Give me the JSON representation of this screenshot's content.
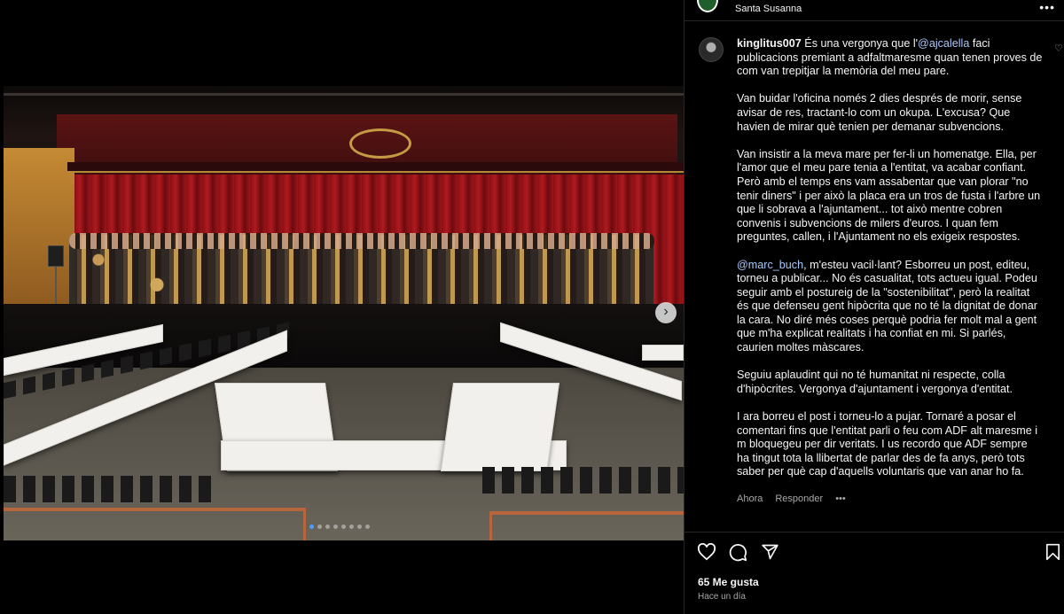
{
  "post": {
    "location": "Santa Susanna",
    "more_icon": "more-horizontal-icon",
    "likes_text": "65 Me gusta",
    "time_text": "Hace un día"
  },
  "carousel": {
    "next_icon": "›",
    "dot_count": 8,
    "active_index": 0
  },
  "comment": {
    "username": "kinglitus007",
    "mention_1": "@ajcalella",
    "p1_before": "És una vergonya que l'",
    "p1_after": " faci publicacions premiant a adfaltmaresme quan tenen proves de com van trepitjar la memòria del meu pare.",
    "p2": "Van buidar l'oficina només 2 dies després de morir, sense avisar de res, tractant-lo com un okupa. L'excusa? Que havien de mirar què tenien per demanar subvencions.",
    "p3": "Van insistir a la meva mare per fer-li un homenatge. Ella, per l'amor que el meu pare tenia a l'entitat, va acabar confiant. Però amb el temps ens vam assabentar que van plorar \"no tenir diners\" i per això la placa era un tros de fusta i l'arbre un que li sobrava a l'ajuntament... tot això mentre cobren convenis i subvencions de milers d'euros. I quan fem preguntes, callen, i l'Ajuntament no els exigeix respostes.",
    "mention_2": "@marc_buch",
    "p4_after": ", m'esteu vacil·lant? Esborreu un post, editeu, torneu a publicar... No és casualitat, tots actueu igual. Podeu seguir amb el postureig de la \"sostenibilitat\", però la realitat és que defenseu gent hipòcrita que no té la dignitat de donar la cara. No diré més coses perquè podria fer molt mal a gent que m'ha explicat realitats i ha confiat en mi. Si parlés, caurien moltes màscares.",
    "p5": "Seguiu aplaudint qui no té humanitat ni respecte, colla d'hipòcrites. Vergonya d'ajuntament i vergonya d'entitat.",
    "p6": "I ara borreu el post i torneu-lo a pujar. Tornaré a posar el comentari fins que l'entitat parli o feu com ADF alt maresme i m bloquegeu per dir veritats. I us recordo que ADF sempre ha tingut tota la llibertat de parlar des de fa anys, però tots saber per què cap d'aquells voluntaris que van anar ho fa.",
    "time": "Ahora",
    "reply": "Responder",
    "more": "•••"
  },
  "icons": {
    "like": "heart-icon",
    "comment": "comment-icon",
    "share": "send-icon",
    "save": "bookmark-icon"
  }
}
